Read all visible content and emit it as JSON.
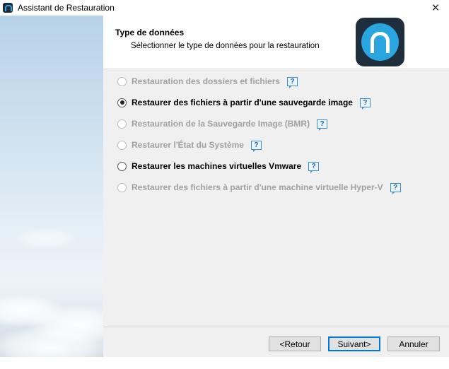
{
  "window": {
    "title": "Assistant de Restauration",
    "close_glyph": "✕"
  },
  "header": {
    "title": "Type de données",
    "subtitle": "Sélectionner le type de données pour la restauration"
  },
  "options": [
    {
      "label": "Restauration des dossiers et fichiers",
      "enabled": false,
      "checked": false
    },
    {
      "label": "Restaurer des fichiers à partir d'une  sauvegarde image",
      "enabled": true,
      "checked": true
    },
    {
      "label": "Restauration de la Sauvegarde Image (BMR)",
      "enabled": false,
      "checked": false
    },
    {
      "label": "Restaurer l'État du Système",
      "enabled": false,
      "checked": false
    },
    {
      "label": "Restaurer les machines virtuelles Vmware",
      "enabled": true,
      "checked": false
    },
    {
      "label": "Restaurer des fichiers à partir d'une machine virtuelle Hyper-V",
      "enabled": false,
      "checked": false
    }
  ],
  "help_glyph": "?",
  "buttons": {
    "back": "<Retour",
    "next": "Suivant>",
    "cancel": "Annuler"
  },
  "colors": {
    "accent": "#0078d7",
    "logo_blue": "#29a6e0",
    "logo_dark": "#1f2e3d",
    "disabled_text": "#a0a0a0"
  }
}
